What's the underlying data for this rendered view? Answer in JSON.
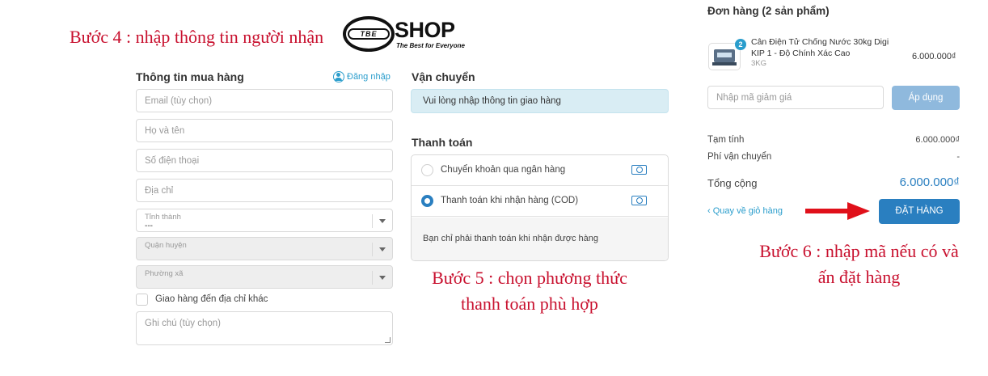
{
  "annotations": {
    "step4": "Bước 4 : nhập thông tin người nhận",
    "step5_line1": "Bước 5 : chọn phương thức",
    "step5_line2": "thanh toán phù hợp",
    "step6_line1": "Bước 6 : nhập mã nếu có và",
    "step6_line2": "ấn đặt hàng"
  },
  "logo": {
    "mark": "TBE",
    "name": "SHOP",
    "tagline": "The Best for Everyone"
  },
  "customer": {
    "title": "Thông tin mua hàng",
    "login_label": "Đăng nhập",
    "email_placeholder": "Email (tùy chọn)",
    "name_placeholder": "Họ và tên",
    "phone_placeholder": "Số điện thoại",
    "address_placeholder": "Địa chỉ",
    "province": {
      "label": "Tỉnh thành",
      "value": "---"
    },
    "district": {
      "label": "Quận huyện"
    },
    "ward": {
      "label": "Phường xã"
    },
    "ship_other_label": "Giao hàng đến địa chỉ khác",
    "note_placeholder": "Ghi chú (tùy chọn)"
  },
  "shipping": {
    "title": "Vận chuyển",
    "message": "Vui lòng nhập thông tin giao hàng"
  },
  "payment": {
    "title": "Thanh toán",
    "options": [
      {
        "label": "Chuyển khoản qua ngân hàng",
        "selected": false,
        "icon": "cash-icon"
      },
      {
        "label": "Thanh toán khi nhận hàng (COD)",
        "selected": true,
        "icon": "cash-icon"
      }
    ],
    "cod_description": "Bạn chỉ phải thanh toán khi nhận được hàng"
  },
  "order": {
    "title": "Đơn hàng (2 sản phẩm)",
    "item": {
      "quantity": "2",
      "name": "Cân Điện Tử Chống Nước 30kg Digi KIP 1 - Độ Chính Xác Cao",
      "variant": "3KG",
      "price": "6.000.000₫"
    },
    "coupon_placeholder": "Nhập mã giảm giá",
    "apply_label": "Áp dụng",
    "subtotal_label": "Tạm tính",
    "subtotal_value": "6.000.000₫",
    "shipping_fee_label": "Phí vận chuyển",
    "shipping_fee_value": "-",
    "total_label": "Tổng cộng",
    "total_value": "6.000.000₫",
    "back_label": "‹ Quay về giỏ hàng",
    "place_order_label": "ĐẶT HÀNG"
  },
  "colors": {
    "annotation": "#c8102e",
    "accent": "#2a7fc0",
    "link": "#2a9dcc",
    "arrow": "#e0101a"
  }
}
